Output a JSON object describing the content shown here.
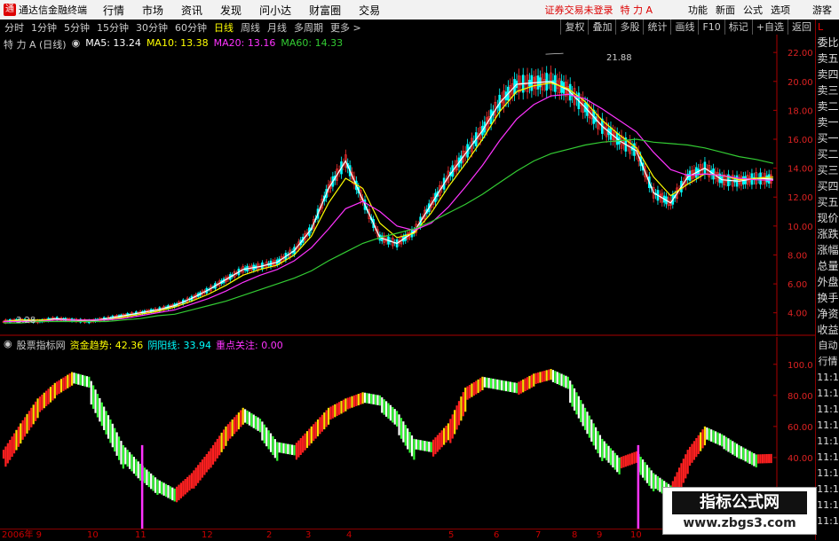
{
  "app": {
    "title": "通达信金融终端",
    "logo": "tdx-logo-icon"
  },
  "menu": [
    "行情",
    "市场",
    "资讯",
    "发现",
    "问小达",
    "财富圈",
    "交易"
  ],
  "status": {
    "login": "证券交易未登录",
    "stock": "特 力 A"
  },
  "right_menu": [
    "功能",
    "新面",
    "公式",
    "选项"
  ],
  "guest_label": "游客",
  "periods": [
    "分时",
    "1分钟",
    "5分钟",
    "15分钟",
    "30分钟",
    "60分钟",
    "日线",
    "周线",
    "月线",
    "多周期",
    "更多 >"
  ],
  "active_period": "日线",
  "tools": [
    "复权",
    "叠加",
    "多股",
    "统计",
    "画线",
    "F10",
    "标记",
    "+自选",
    "返回"
  ],
  "chart_title": "特 力 A (日线)",
  "ma": [
    {
      "label": "MA5: 13.24",
      "color": "#ffffff"
    },
    {
      "label": "MA10: 13.38",
      "color": "#ffff00"
    },
    {
      "label": "MA20: 13.16",
      "color": "#ff33ff"
    },
    {
      "label": "MA60: 14.33",
      "color": "#33cc33"
    }
  ],
  "sub_indicator": {
    "name": "股票指标网",
    "items": [
      {
        "label": "资金趋势: 42.36",
        "color": "#ffff00"
      },
      {
        "label": "阴阳线: 33.94",
        "color": "#00ffff"
      },
      {
        "label": "重点关注: 0.00",
        "color": "#ff33ff"
      }
    ]
  },
  "high_label": "21.88",
  "low_label": "3.28",
  "price_axis": [
    "22.00",
    "20.00",
    "18.00",
    "16.00",
    "14.00",
    "12.00",
    "10.00",
    "8.00",
    "6.00",
    "4.00"
  ],
  "sub_axis": [
    "100.0",
    "80.00",
    "60.00",
    "40.00"
  ],
  "side_top": "L",
  "side_items": [
    "委比",
    "卖五",
    "卖四",
    "卖三",
    "卖二",
    "卖一",
    "买一",
    "买二",
    "买三",
    "买四",
    "买五",
    "现价",
    "涨跌",
    "涨幅",
    "总量",
    "外盘",
    "换手",
    "净资",
    "收益",
    "自动",
    "行情",
    "11:1",
    "11:1",
    "11:1",
    "11:1",
    "11:1",
    "11:1",
    "11:1",
    "11:1",
    "11:1",
    "11:1"
  ],
  "x_labels": [
    "2006年 9",
    "10",
    "11",
    "12",
    "2",
    "3",
    "4",
    "5",
    "6",
    "7",
    "8",
    "9",
    "10"
  ],
  "watermark": {
    "title": "指标公式网",
    "url": "www.zbgs3.com"
  },
  "chart_data": {
    "type": "line",
    "x_start": "2006-09",
    "price_ylim": [
      3.0,
      22.5
    ],
    "indicator_ylim": [
      0,
      105
    ],
    "series": [
      {
        "name": "MA5",
        "values": [
          3.4,
          3.5,
          3.4,
          3.6,
          3.5,
          3.4,
          3.6,
          3.8,
          4.0,
          4.2,
          4.5,
          5.0,
          5.6,
          6.3,
          7.0,
          7.2,
          7.5,
          8.3,
          9.8,
          12.6,
          14.5,
          11.8,
          9.2,
          8.8,
          9.6,
          11.5,
          13.4,
          15.0,
          16.6,
          18.5,
          19.8,
          19.9,
          20.0,
          19.4,
          18.2,
          16.9,
          15.9,
          15.2,
          12.3,
          11.6,
          13.4,
          14.0,
          13.2,
          13.1,
          13.3,
          13.24
        ]
      },
      {
        "name": "MA10",
        "values": [
          3.4,
          3.5,
          3.5,
          3.5,
          3.5,
          3.5,
          3.5,
          3.7,
          3.9,
          4.1,
          4.4,
          4.8,
          5.3,
          5.9,
          6.6,
          7.0,
          7.3,
          8.0,
          9.3,
          11.6,
          13.3,
          12.6,
          10.2,
          9.2,
          9.5,
          10.9,
          12.7,
          14.3,
          16.0,
          17.9,
          19.3,
          19.7,
          19.9,
          19.5,
          18.6,
          17.3,
          16.3,
          15.4,
          13.4,
          12.1,
          12.9,
          13.6,
          13.5,
          13.2,
          13.3,
          13.38
        ]
      },
      {
        "name": "MA20",
        "values": [
          3.4,
          3.4,
          3.4,
          3.5,
          3.5,
          3.5,
          3.5,
          3.6,
          3.8,
          4.0,
          4.2,
          4.6,
          5.0,
          5.5,
          6.1,
          6.6,
          7.0,
          7.6,
          8.5,
          9.8,
          11.2,
          11.7,
          11.0,
          10.0,
          9.7,
          10.2,
          11.3,
          12.7,
          14.2,
          15.9,
          17.4,
          18.4,
          19.0,
          19.1,
          18.8,
          18.1,
          17.3,
          16.5,
          15.1,
          13.9,
          13.5,
          13.6,
          13.5,
          13.3,
          13.2,
          13.16
        ]
      },
      {
        "name": "MA60",
        "values": [
          3.3,
          3.3,
          3.4,
          3.4,
          3.4,
          3.4,
          3.4,
          3.5,
          3.6,
          3.8,
          3.9,
          4.2,
          4.5,
          4.8,
          5.2,
          5.6,
          6.0,
          6.4,
          6.9,
          7.6,
          8.2,
          8.8,
          9.2,
          9.5,
          9.8,
          10.3,
          10.9,
          11.5,
          12.2,
          13.0,
          13.8,
          14.5,
          15.0,
          15.3,
          15.6,
          15.8,
          15.9,
          16.0,
          15.8,
          15.7,
          15.6,
          15.4,
          15.1,
          14.8,
          14.6,
          14.33
        ]
      },
      {
        "name": "资金趋势",
        "values": [
          45,
          62,
          78,
          88,
          95,
          92,
          70,
          48,
          36,
          26,
          20,
          30,
          44,
          60,
          72,
          65,
          50,
          48,
          60,
          72,
          78,
          82,
          80,
          70,
          52,
          50,
          62,
          85,
          92,
          90,
          88,
          94,
          97,
          92,
          72,
          52,
          40,
          44,
          30,
          22,
          45,
          60,
          55,
          48,
          42,
          42.36
        ]
      }
    ]
  }
}
